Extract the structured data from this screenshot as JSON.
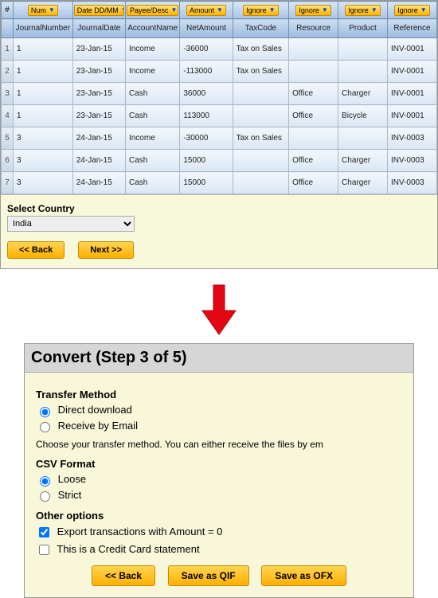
{
  "table": {
    "corner": "#",
    "dropdowns": [
      "Num",
      "Date DD/MM",
      "Payee/Desc",
      "Amount",
      "Ignore",
      "Ignore",
      "Ignore",
      "Ignore"
    ],
    "headers": [
      "JournalNumber",
      "JournalDate",
      "AccountName",
      "NetAmount",
      "TaxCode",
      "Resource",
      "Product",
      "Reference"
    ],
    "rows": [
      {
        "n": "1",
        "c": [
          "1",
          "23-Jan-15",
          "Income",
          "-36000",
          "Tax on Sales",
          "",
          "",
          "INV-0001"
        ]
      },
      {
        "n": "2",
        "c": [
          "1",
          "23-Jan-15",
          "Income",
          "-113000",
          "Tax on Sales",
          "",
          "",
          "INV-0001"
        ]
      },
      {
        "n": "3",
        "c": [
          "1",
          "23-Jan-15",
          "Cash",
          "36000",
          "",
          "Office",
          "Charger",
          "INV-0001"
        ]
      },
      {
        "n": "4",
        "c": [
          "1",
          "23-Jan-15",
          "Cash",
          "113000",
          "",
          "Office",
          "Bicycle",
          "INV-0001"
        ]
      },
      {
        "n": "5",
        "c": [
          "3",
          "24-Jan-15",
          "Income",
          "-30000",
          "Tax on Sales",
          "",
          "",
          "INV-0003"
        ]
      },
      {
        "n": "6",
        "c": [
          "3",
          "24-Jan-15",
          "Cash",
          "15000",
          "",
          "Office",
          "Charger",
          "INV-0003"
        ]
      },
      {
        "n": "7",
        "c": [
          "3",
          "24-Jan-15",
          "Cash",
          "15000",
          "",
          "Office",
          "Charger",
          "INV-0003"
        ]
      }
    ]
  },
  "country": {
    "label": "Select Country",
    "value": "India"
  },
  "nav": {
    "back": "<< Back",
    "next": "Next >>"
  },
  "step3": {
    "title": "Convert (Step 3 of 5)",
    "transfer_heading": "Transfer Method",
    "opt_direct": "Direct download",
    "opt_email": "Receive by Email",
    "help": "Choose your transfer method. You can either receive the files by em",
    "csv_heading": "CSV Format",
    "opt_loose": "Loose",
    "opt_strict": "Strict",
    "other_heading": "Other options",
    "chk_zero": "Export transactions with Amount = 0",
    "chk_cc": "This is a Credit Card statement",
    "btn_back": "<< Back",
    "btn_qif": "Save as QIF",
    "btn_ofx": "Save as OFX"
  }
}
